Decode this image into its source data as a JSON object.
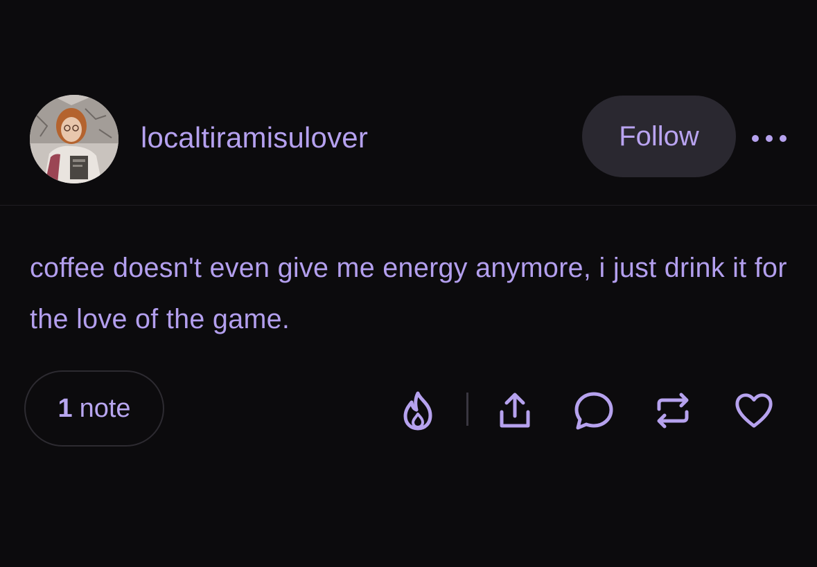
{
  "post": {
    "username": "localtiramisulover",
    "follow_label": "Follow",
    "content": "coffee doesn't even give me energy anymore, i just drink it for the love of the game.",
    "notes": {
      "count": "1",
      "label": "note"
    },
    "actions": [
      {
        "icon": "flame-icon"
      },
      {
        "icon": "share-icon"
      },
      {
        "icon": "reply-icon"
      },
      {
        "icon": "reblog-icon"
      },
      {
        "icon": "heart-icon"
      }
    ]
  },
  "colors": {
    "background": "#0c0b0d",
    "accent": "#b6a2ee",
    "button_bg": "#2a2830"
  }
}
